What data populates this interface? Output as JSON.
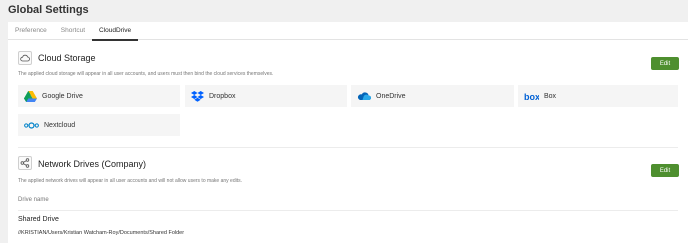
{
  "page": {
    "title": "Global Settings"
  },
  "tabs": [
    {
      "label": "Preference",
      "active": false
    },
    {
      "label": "Shortcut",
      "active": false
    },
    {
      "label": "CloudDrive",
      "active": true
    }
  ],
  "cloud_storage": {
    "title": "Cloud Storage",
    "description": "The applied cloud storage will appear in all user accounts, and users must then bind the cloud services themselves.",
    "edit_label": "Edit",
    "icon": "cloud-icon",
    "providers": [
      {
        "label": "Google Drive",
        "icon": "google-drive-icon"
      },
      {
        "label": "Dropbox",
        "icon": "dropbox-icon"
      },
      {
        "label": "OneDrive",
        "icon": "onedrive-icon"
      },
      {
        "label": "Box",
        "icon": "box-icon"
      },
      {
        "label": "Nextcloud",
        "icon": "nextcloud-icon"
      }
    ]
  },
  "network_drives": {
    "title": "Network Drives (Company)",
    "description": "The applied network drives will appear in all user accounts and will not allow users to make any edits.",
    "edit_label": "Edit",
    "icon": "share-icon",
    "column_header": "Drive name",
    "drives": [
      {
        "name": "Shared Drive",
        "path": "//KRISTIAN/Users/Kristian Watcham-Roy/Documents/Shared Folder"
      }
    ]
  },
  "colors": {
    "accent": "#4e8f2f",
    "card_background": "#f5f5f5",
    "page_background": "#f0f0f0"
  }
}
